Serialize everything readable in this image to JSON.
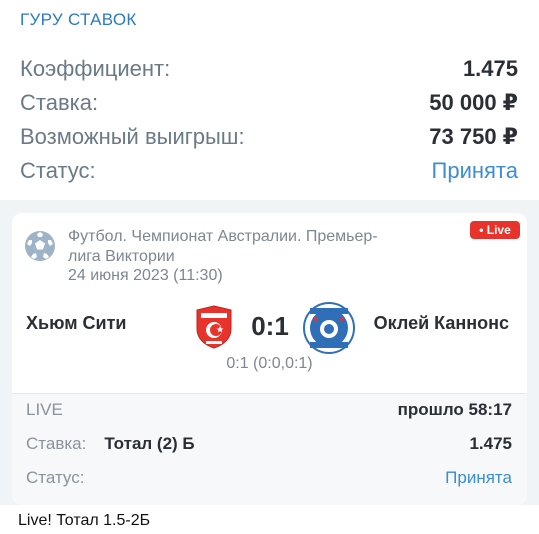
{
  "channel": {
    "name": "ГУРУ СТАВОК"
  },
  "summary": {
    "rows": [
      {
        "label": "Коэффициент:",
        "value": "1.475"
      },
      {
        "label": "Ставка:",
        "value": "50 000 ₽"
      },
      {
        "label": "Возможный выигрыш:",
        "value": "73 750 ₽"
      },
      {
        "label": "Статус:",
        "value": "Принята"
      }
    ]
  },
  "match": {
    "league_line1": "Футбол. Чемпионат Австралии. Премьер-",
    "league_line2": "лига Виктории",
    "datetime": "24 июня 2023 (11:30)",
    "live_badge": "• Live",
    "team_home": "Хьюм Сити",
    "team_away": "Оклей Каннонс",
    "score": "0:1",
    "subscore": "0:1 (0:0,0:1)"
  },
  "bet": {
    "live_label": "LIVE",
    "elapsed": "прошло 58:17",
    "stake_label": "Ставка:",
    "stake_market": "Тотал (2) Б",
    "stake_odds": "1.475",
    "status_label": "Статус:",
    "status_value": "Принята"
  },
  "caption": "Live! Тотал 1.5-2Б",
  "colors": {
    "accent": "#3c8cd6",
    "live": "#e8332d",
    "channel": "#2a7bbf"
  },
  "icons": {
    "sport": "soccer-ball-icon",
    "home_logo": "team-crest-icon",
    "away_logo": "team-crest-icon"
  }
}
